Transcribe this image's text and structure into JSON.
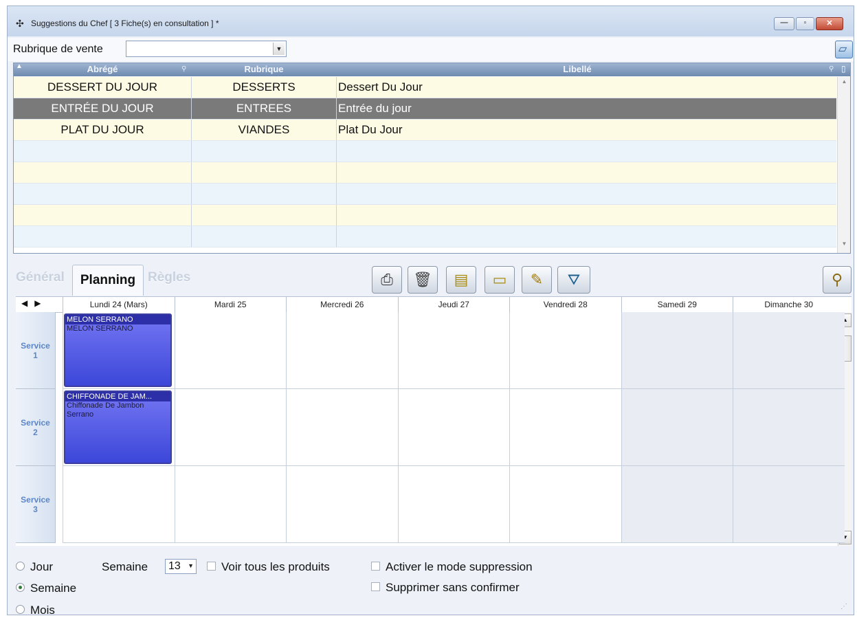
{
  "window": {
    "title": "Suggestions du Chef  [ 3 Fiche(s) en consultation ] *",
    "icons": [
      "app-icon",
      "minimize-icon",
      "maximize-icon",
      "close-icon"
    ]
  },
  "filter": {
    "label": "Rubrique de vente",
    "value": "",
    "icons": [
      "chevron-down-icon",
      "eraser-icon"
    ]
  },
  "grid": {
    "columns": [
      "Abrégé",
      "Rubrique",
      "Libellé"
    ],
    "rows": [
      {
        "abrege": "DESSERT DU JOUR",
        "rubrique": "DESSERTS",
        "libelle": "Dessert Du Jour",
        "selected": false
      },
      {
        "abrege": "ENTRÉE DU JOUR",
        "rubrique": "ENTREES",
        "libelle": "Entrée du jour",
        "selected": true
      },
      {
        "abrege": "PLAT DU JOUR",
        "rubrique": "VIANDES",
        "libelle": "Plat Du Jour",
        "selected": false
      }
    ],
    "empty_row_count": 5,
    "row_colors": {
      "even": "#fdfbe3",
      "odd": "#ebf3fb",
      "selected": "#7a7a7a"
    }
  },
  "tabs": {
    "general": "Général",
    "planning": "Planning",
    "regles": "Règles",
    "active": "Planning"
  },
  "toolbar": {
    "icons": [
      "printer-icon",
      "trash-icon",
      "new-card-icon",
      "folder-icon",
      "edit-icon",
      "filter-icon",
      "zoom-icon"
    ]
  },
  "calendar": {
    "days": [
      "Lundi 24 (Mars)",
      "Mardi 25",
      "Mercredi 26",
      "Jeudi 27",
      "Vendredi 28",
      "Samedi 29",
      "Dimanche 30"
    ],
    "weekend": [
      "Samedi 29",
      "Dimanche 30"
    ],
    "services": [
      {
        "line1": "Service",
        "line2": "1"
      },
      {
        "line1": "Service",
        "line2": "2"
      },
      {
        "line1": "Service",
        "line2": "3"
      }
    ],
    "events": [
      {
        "day": 0,
        "service": 0,
        "header": "MELON SERRANO",
        "body": "MELON SERRANO"
      },
      {
        "day": 0,
        "service": 1,
        "header": "CHIFFONADE DE JAM...",
        "body": "Chiffonade De Jambon Serrano"
      }
    ],
    "colors": {
      "event": "#4a52e0",
      "weekend": "#e9edf3"
    }
  },
  "options": {
    "jour": "Jour",
    "semaine_radio": "Semaine",
    "mois": "Mois",
    "selected_view": "Semaine",
    "semaine_label": "Semaine",
    "week_number": "13",
    "voir_tous": "Voir tous les produits",
    "activer_suppression": "Activer le mode suppression",
    "supprimer_sans_confirmer": "Supprimer sans confirmer"
  }
}
